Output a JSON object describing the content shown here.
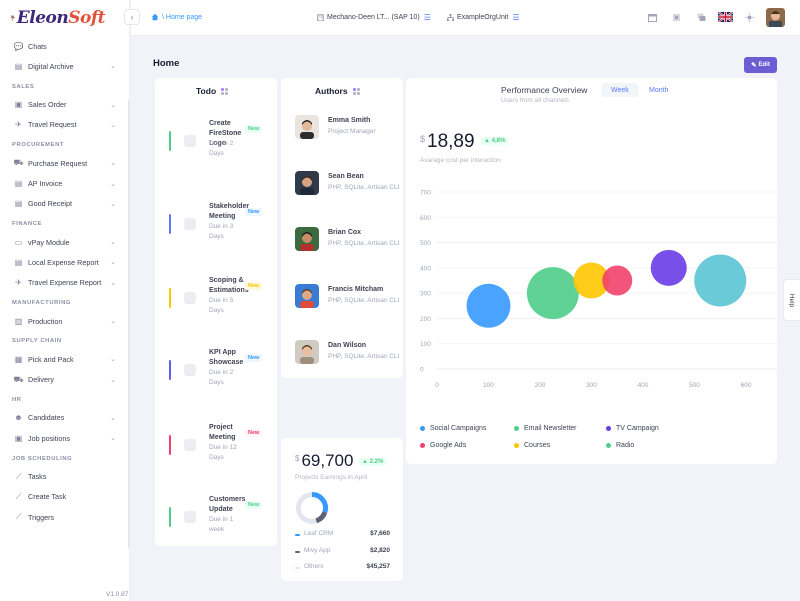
{
  "brand": {
    "name_part1": "Eleon",
    "name_part2": "Soft"
  },
  "version": "V1.0.87",
  "topbar": {
    "breadcrumb": "\\ Home page",
    "company": "Mechano-Deen LT... (SAP 10)",
    "org_unit": "ExampleOrgUnit",
    "language_flag": "uk-flag-icon"
  },
  "sidebar": {
    "items": [
      {
        "label": "Chats",
        "icon": "chat-icon",
        "chevron": false
      },
      {
        "label": "Digital Archive",
        "icon": "archive-icon",
        "chevron": true
      }
    ],
    "sections": [
      {
        "title": "SALES",
        "items": [
          {
            "label": "Sales Order",
            "icon": "bag-icon",
            "chevron": true
          },
          {
            "label": "Travel Request",
            "icon": "plane-icon",
            "chevron": true
          }
        ]
      },
      {
        "title": "PROCUREMENT",
        "items": [
          {
            "label": "Purchase Request",
            "icon": "cart-icon",
            "chevron": true
          },
          {
            "label": "AP Invoice",
            "icon": "document-icon",
            "chevron": true
          },
          {
            "label": "Good Receipt",
            "icon": "document-icon",
            "chevron": true
          }
        ]
      },
      {
        "title": "FINANCE",
        "items": [
          {
            "label": "vPay Module",
            "icon": "card-icon",
            "chevron": true
          },
          {
            "label": "Local Expense Report",
            "icon": "report-icon",
            "chevron": true
          },
          {
            "label": "Travel Expense Report",
            "icon": "plane-icon",
            "chevron": true
          }
        ]
      },
      {
        "title": "MANUFACTURING",
        "items": [
          {
            "label": "Production",
            "icon": "factory-icon",
            "chevron": true
          }
        ]
      },
      {
        "title": "SUPPLY CHAIN",
        "items": [
          {
            "label": "Pick and Pack",
            "icon": "box-icon",
            "chevron": true
          },
          {
            "label": "Delivery",
            "icon": "truck-icon",
            "chevron": true
          }
        ]
      },
      {
        "title": "HR",
        "items": [
          {
            "label": "Candidates",
            "icon": "people-icon",
            "chevron": true
          },
          {
            "label": "Job positions",
            "icon": "briefcase-icon",
            "chevron": true
          }
        ]
      },
      {
        "title": "JOB SCHEDULING",
        "items": [
          {
            "label": "Tasks",
            "icon": "chart-line-icon",
            "chevron": false
          },
          {
            "label": "Create Task",
            "icon": "chart-line-icon",
            "chevron": false
          },
          {
            "label": "Triggers",
            "icon": "chart-line-icon",
            "chevron": false
          }
        ]
      }
    ]
  },
  "page": {
    "title": "Home",
    "edit_label": "Edit"
  },
  "todo": {
    "title": "Todo",
    "items": [
      {
        "title": "Create FireStone Logo",
        "due": "Due in 2 Days",
        "badge": "New",
        "color": "#50cd89",
        "badge_bg": "#e8fff3",
        "badge_fg": "#50cd89"
      },
      {
        "title": "Stakeholder Meeting",
        "due": "Due in 3 Days",
        "badge": "New",
        "color": "#5d78ff",
        "badge_bg": "#eef6ff",
        "badge_fg": "#3699ff"
      },
      {
        "title": "Scoping & Estimations",
        "due": "Due in 5 Days",
        "badge": "New",
        "color": "#ffc700",
        "badge_bg": "#fff8dd",
        "badge_fg": "#ffc700"
      },
      {
        "title": "KPI App Showcase",
        "due": "Due in 2 Days",
        "badge": "New",
        "color": "#5d5fef",
        "badge_bg": "#eef6ff",
        "badge_fg": "#3699ff"
      },
      {
        "title": "Project Meeting",
        "due": "Due in 12 Days",
        "badge": "New",
        "color": "#f1416c",
        "badge_bg": "#fff5f8",
        "badge_fg": "#f1416c"
      },
      {
        "title": "Customers Update",
        "due": "Due in 1 week",
        "badge": "New",
        "color": "#50cd89",
        "badge_bg": "#e8fff3",
        "badge_fg": "#50cd89"
      }
    ]
  },
  "authors": {
    "title": "Authors",
    "items": [
      {
        "name": "Emma Smith",
        "role": "Project Manager"
      },
      {
        "name": "Sean Bean",
        "role": "PHP, SQLite, Artisan CLI"
      },
      {
        "name": "Brian Cox",
        "role": "PHP, SQLite, Artisan CLI"
      },
      {
        "name": "Francis Mitcham",
        "role": "PHP, SQLite, Artisan CLI"
      },
      {
        "name": "Dan Wilson",
        "role": "PHP, SQLite, Artisan CLI"
      }
    ]
  },
  "earnings": {
    "currency": "$",
    "value": "69,700",
    "change": "2.2%",
    "subtitle": "Projects Earnings in April",
    "rows": [
      {
        "label": "Leaf CRM",
        "value": "$7,660",
        "color": "#3699ff",
        "share": 0.3
      },
      {
        "label": "Mivy App",
        "value": "$2,820",
        "color": "#5e6278",
        "share": 0.15
      },
      {
        "label": "Others",
        "value": "$45,257",
        "color": "#e4e6ef",
        "share": 0.55
      }
    ]
  },
  "performance": {
    "title": "Performance Overview",
    "subtitle": "Users from all channels",
    "tabs": [
      "Week",
      "Month"
    ],
    "active_tab": "Week",
    "currency": "$",
    "value": "18,89",
    "change": "4,8%",
    "caption": "Avarage cost per interaction"
  },
  "chart_data": {
    "type": "scatter",
    "xlim": [
      0,
      600
    ],
    "ylim": [
      0,
      700
    ],
    "x_ticks": [
      0,
      100,
      200,
      300,
      400,
      500,
      600
    ],
    "y_ticks": [
      0,
      100,
      200,
      300,
      400,
      500,
      600,
      700
    ],
    "grid": true,
    "points": [
      {
        "x": 100,
        "y": 250,
        "size": 22,
        "color": "#3699ff"
      },
      {
        "x": 225,
        "y": 300,
        "size": 26,
        "color": "#50cd89"
      },
      {
        "x": 300,
        "y": 350,
        "size": 18,
        "color": "#ffc700"
      },
      {
        "x": 350,
        "y": 350,
        "size": 15,
        "color": "#f1416c"
      },
      {
        "x": 450,
        "y": 400,
        "size": 18,
        "color": "#6a3ce8"
      },
      {
        "x": 550,
        "y": 350,
        "size": 26,
        "color": "#5bc4d3"
      }
    ],
    "legend": [
      {
        "label": "Social Campaigns",
        "color": "#3699ff"
      },
      {
        "label": "Email Newsletter",
        "color": "#50cd89"
      },
      {
        "label": "TV Campaign",
        "color": "#6a3ce8"
      },
      {
        "label": "Google Ads",
        "color": "#f1416c"
      },
      {
        "label": "Courses",
        "color": "#ffc700"
      },
      {
        "label": "Radio",
        "color": "#50cd89"
      }
    ]
  },
  "help_label": "Help"
}
